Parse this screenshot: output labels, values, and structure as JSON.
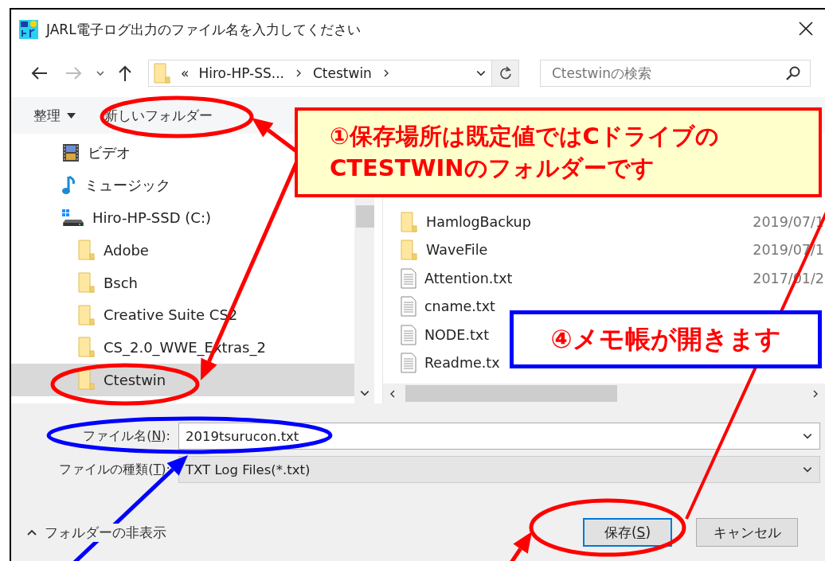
{
  "window": {
    "title": "JARL電子ログ出力のファイル名を入力してください"
  },
  "address": {
    "overflow_glyph": "«",
    "crumbs": [
      "Hiro-HP-SS...",
      "Ctestwin"
    ]
  },
  "search": {
    "placeholder": "Ctestwinの検索"
  },
  "toolbar": {
    "organize": "整理",
    "new_folder": "新しいフォルダー"
  },
  "nav_tree": [
    {
      "label": "ビデオ",
      "kind": "video",
      "selected": false
    },
    {
      "label": "ミュージック",
      "kind": "music",
      "selected": false
    },
    {
      "label": "Hiro-HP-SSD (C:)",
      "kind": "drive",
      "selected": false,
      "children": [
        {
          "label": "Adobe",
          "kind": "folder",
          "selected": false
        },
        {
          "label": "Bsch",
          "kind": "folder",
          "selected": false
        },
        {
          "label": "Creative Suite CS2",
          "kind": "folder",
          "selected": false
        },
        {
          "label": "CS_2.0_WWE_Extras_2",
          "kind": "folder",
          "selected": false
        },
        {
          "label": "Ctestwin",
          "kind": "folder",
          "selected": true
        }
      ]
    }
  ],
  "files": [
    {
      "name": "HamlogBackup",
      "kind": "folder",
      "date": "2019/07/1"
    },
    {
      "name": "WaveFile",
      "kind": "folder",
      "date": "2019/07/1"
    },
    {
      "name": "Attention.txt",
      "kind": "text",
      "date": "2017/01/2"
    },
    {
      "name": "cname.txt",
      "kind": "text"
    },
    {
      "name": "NODE.txt",
      "kind": "text"
    },
    {
      "name": "Readme.tx",
      "kind": "text"
    }
  ],
  "file_name": {
    "label_before": "ファイル名(",
    "accelerator": "N",
    "label_after": "):",
    "value": "2019tsurucon.txt"
  },
  "file_type": {
    "label_before": "ファイルの種類(",
    "accelerator": "T",
    "label_after": "):",
    "value": "TXT Log Files(*.txt)"
  },
  "hide_folders": "フォルダーの非表示",
  "buttons": [
    {
      "label_before": "保存(",
      "accelerator": "S",
      "label_after": ")",
      "default": true
    },
    {
      "label_before": "キャンセル",
      "default": false
    }
  ],
  "callouts": [
    {
      "kind": "note",
      "color": "#ff0000",
      "lines": [
        "①保存場所は既定値ではCドライブの",
        "CTESTWINのフォルダーです"
      ]
    },
    {
      "kind": "step",
      "color": "#0000ff",
      "lines": [
        "④メモ帳が開きます"
      ]
    }
  ]
}
